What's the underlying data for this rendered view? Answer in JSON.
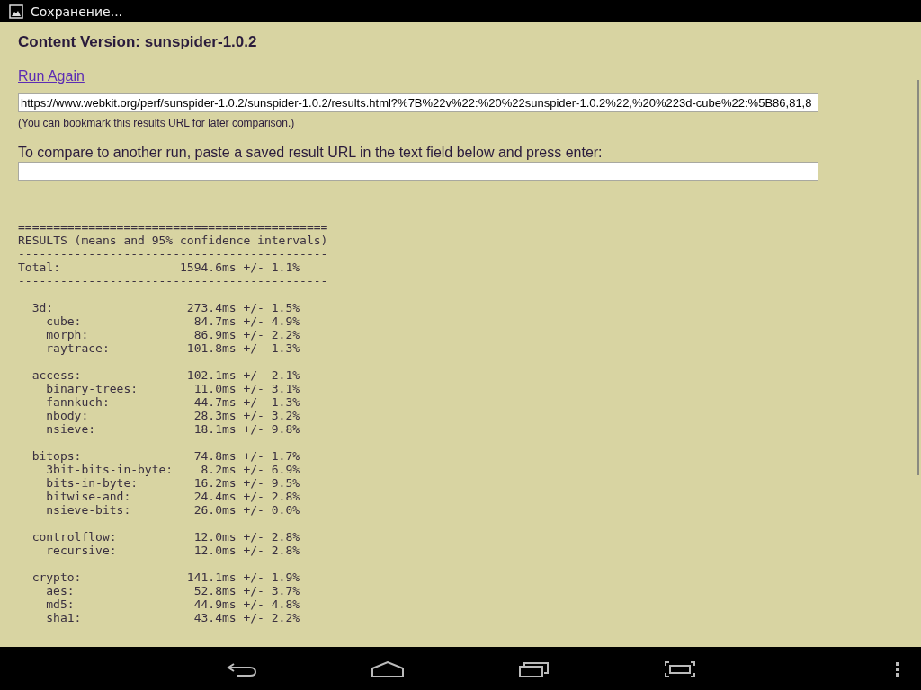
{
  "status_bar": {
    "notification": "Сохранение..."
  },
  "page": {
    "heading": "Content Version: sunspider-1.0.2",
    "run_again": "Run Again",
    "results_url": "https://www.webkit.org/perf/sunspider-1.0.2/sunspider-1.0.2/results.html?%7B%22v%22:%20%22sunspider-1.0.2%22,%20%223d-cube%22:%5B86,81,8",
    "bookmark_note": "(You can bookmark this results URL for later comparison.)",
    "compare_label": "To compare to another run, paste a saved result URL in the text field below and press enter:"
  },
  "results": {
    "rule_top": "============================================",
    "title": "RESULTS (means and 95% confidence intervals)",
    "rule_mid": "--------------------------------------------",
    "total_label": "Total:",
    "total_value": "1594.6ms +/- 1.1%",
    "rule_bottom": "--------------------------------------------",
    "groups": [
      {
        "name": "3d:",
        "value": "273.4ms +/- 1.5%",
        "tests": [
          {
            "name": "cube:",
            "value": "84.7ms +/- 4.9%"
          },
          {
            "name": "morph:",
            "value": "86.9ms +/- 2.2%"
          },
          {
            "name": "raytrace:",
            "value": "101.8ms +/- 1.3%"
          }
        ]
      },
      {
        "name": "access:",
        "value": "102.1ms +/- 2.1%",
        "tests": [
          {
            "name": "binary-trees:",
            "value": "11.0ms +/- 3.1%"
          },
          {
            "name": "fannkuch:",
            "value": "44.7ms +/- 1.3%"
          },
          {
            "name": "nbody:",
            "value": "28.3ms +/- 3.2%"
          },
          {
            "name": "nsieve:",
            "value": "18.1ms +/- 9.8%"
          }
        ]
      },
      {
        "name": "bitops:",
        "value": "74.8ms +/- 1.7%",
        "tests": [
          {
            "name": "3bit-bits-in-byte:",
            "value": "8.2ms +/- 6.9%"
          },
          {
            "name": "bits-in-byte:",
            "value": "16.2ms +/- 9.5%"
          },
          {
            "name": "bitwise-and:",
            "value": "24.4ms +/- 2.8%"
          },
          {
            "name": "nsieve-bits:",
            "value": "26.0ms +/- 0.0%"
          }
        ]
      },
      {
        "name": "controlflow:",
        "value": "12.0ms +/- 2.8%",
        "tests": [
          {
            "name": "recursive:",
            "value": "12.0ms +/- 2.8%"
          }
        ]
      },
      {
        "name": "crypto:",
        "value": "141.1ms +/- 1.9%",
        "tests": [
          {
            "name": "aes:",
            "value": "52.8ms +/- 3.7%"
          },
          {
            "name": "md5:",
            "value": "44.9ms +/- 4.8%"
          },
          {
            "name": "sha1:",
            "value": "43.4ms +/- 2.2%"
          }
        ]
      }
    ]
  }
}
